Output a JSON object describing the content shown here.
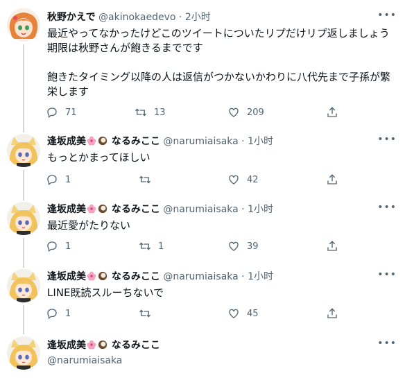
{
  "tweets": [
    {
      "name": "秋野かえで",
      "handle": "@akinokaedevo",
      "time": "· 2小时",
      "text": "最近やってなかったけどこのツイートについたリプだけリプ返しましょう\n期限は秋野さんが飽きるまでです\n\n飽きたタイミング以降の人は返信がつかないかわりに八代先まで子孫が繁\n栄します",
      "reply": "71",
      "retweet": "13",
      "like": "209"
    },
    {
      "name_prefix": "逢坂成美",
      "name_suffix": "なるみここ",
      "handle": "@narumiaisaka",
      "time": "· 1小时",
      "text": "もっとかまってほしい",
      "reply": "1",
      "retweet": "",
      "like": "42"
    },
    {
      "name_prefix": "逢坂成美",
      "name_suffix": "なるみここ",
      "handle": "@narumiaisaka",
      "time": "· 1小时",
      "text": "最近愛がたりない",
      "reply": "1",
      "retweet": "1",
      "like": "39"
    },
    {
      "name_prefix": "逢坂成美",
      "name_suffix": "なるみここ",
      "handle": "@narumiaisaka",
      "time": "· 1小时",
      "text": "LINE既読スルーちないで",
      "reply": "1",
      "retweet": "",
      "like": "45"
    },
    {
      "name_prefix": "逢坂成美",
      "name_suffix": "なるみここ",
      "handle": "@narumiaisaka"
    }
  ],
  "more_label": "•••",
  "icons": {
    "reply": "reply-icon",
    "retweet": "retweet-icon",
    "like": "like-icon",
    "share": "share-icon",
    "flower": "hibiscus-emoji",
    "coconut": "coconut-emoji"
  },
  "colors": {
    "thread_line": "#cfd9de",
    "secondary_text": "#536471",
    "flower": "#f4a6c0",
    "coconut": "#6b4a2b"
  }
}
